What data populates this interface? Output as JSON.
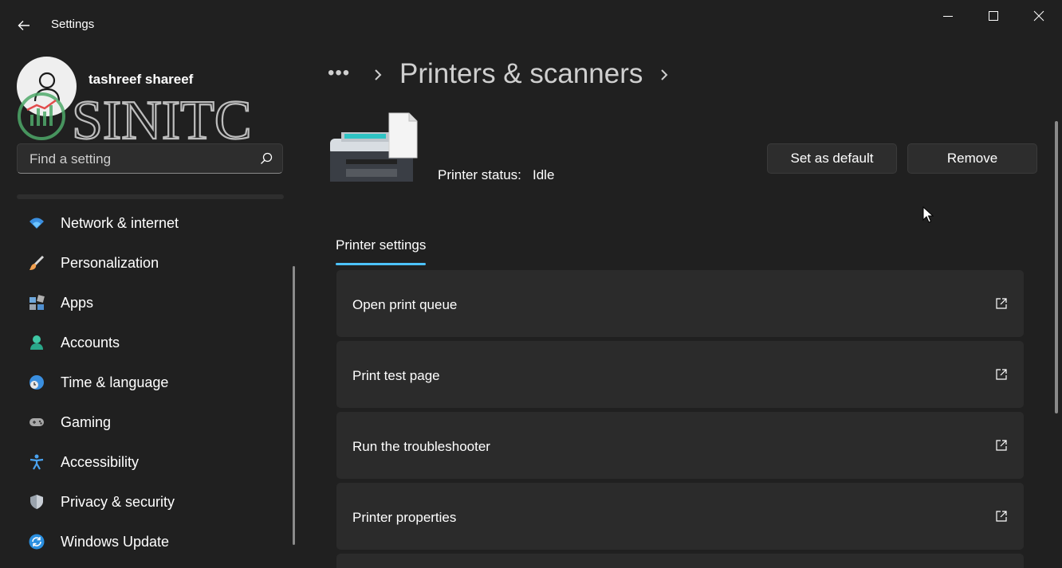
{
  "window": {
    "title": "Settings"
  },
  "profile": {
    "name": "tashreef shareef"
  },
  "watermark": {
    "text": "SINITC"
  },
  "search": {
    "placeholder": "Find a setting"
  },
  "sidebar": {
    "items": [
      {
        "label": "Network & internet",
        "icon": "wifi-icon"
      },
      {
        "label": "Personalization",
        "icon": "brush-icon"
      },
      {
        "label": "Apps",
        "icon": "apps-icon"
      },
      {
        "label": "Accounts",
        "icon": "person-icon"
      },
      {
        "label": "Time & language",
        "icon": "globe-clock-icon"
      },
      {
        "label": "Gaming",
        "icon": "gamepad-icon"
      },
      {
        "label": "Accessibility",
        "icon": "accessibility-icon"
      },
      {
        "label": "Privacy & security",
        "icon": "shield-icon"
      },
      {
        "label": "Windows Update",
        "icon": "update-icon"
      }
    ]
  },
  "breadcrumb": {
    "more": "•••",
    "title": "Printers & scanners"
  },
  "printer": {
    "status_label": "Printer status:",
    "status_value": "Idle"
  },
  "actions": {
    "set_default": "Set as default",
    "remove": "Remove"
  },
  "tabs": [
    {
      "label": "Printer settings",
      "selected": true
    }
  ],
  "cards": [
    {
      "label": "Open print queue"
    },
    {
      "label": "Print test page"
    },
    {
      "label": "Run the troubleshooter"
    },
    {
      "label": "Printer properties"
    }
  ],
  "colors": {
    "background": "#202020",
    "card": "#2b2b2b",
    "accent": "#4cc2ff"
  }
}
